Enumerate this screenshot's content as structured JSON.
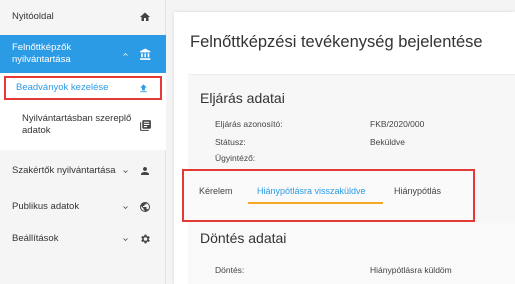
{
  "sidebar": {
    "home": {
      "label": "Nyitóoldal",
      "icon": "home-icon"
    },
    "active_section": {
      "label": "Felnőttképzők nyilvántartása",
      "icon": "bank-icon",
      "chevron": "chevron-up-icon"
    },
    "sub_items": [
      {
        "label": "Beadványok kezelése",
        "icon": "upload-icon"
      },
      {
        "label": "Nyilvántartásban szereplő adatok",
        "icon": "library-books-icon"
      }
    ],
    "sections": [
      {
        "label": "Szakértők nyilvántartása",
        "icon": "person-icon",
        "chevron": "chevron-down-icon"
      },
      {
        "label": "Publikus adatok",
        "icon": "globe-icon",
        "chevron": "chevron-down-icon"
      },
      {
        "label": "Beállítások",
        "icon": "gear-icon",
        "chevron": "chevron-down-icon"
      }
    ]
  },
  "main": {
    "title": "Felnőttképzési tevékenység bejelentése",
    "procedure": {
      "title": "Eljárás adatai",
      "fields": [
        {
          "key": "Eljárás azonosító:",
          "value": "FKB/2020/000"
        },
        {
          "key": "Státusz:",
          "value": "Beküldve"
        },
        {
          "key": "Ügyintéző:",
          "value": ""
        }
      ]
    },
    "tabs": [
      {
        "label": "Kérelem",
        "active": false
      },
      {
        "label": "Hiánypótlásra visszaküldve",
        "active": true
      },
      {
        "label": "Hiánypótlás",
        "active": false
      }
    ],
    "decision": {
      "title": "Döntés adatai",
      "fields": [
        {
          "key": "Döntés:",
          "value": "Hiánypótlásra küldöm"
        }
      ]
    }
  },
  "colors": {
    "accent": "#2b9be6",
    "highlight_border": "#e53935",
    "tab_underline": "#f5a623"
  }
}
